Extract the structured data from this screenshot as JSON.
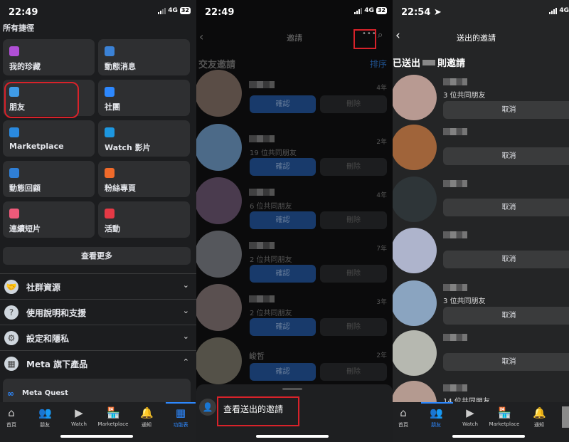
{
  "status_left": {
    "time": "22:49",
    "network": "4G",
    "battery": "32"
  },
  "status_mid": {
    "time": "22:49",
    "network": "4G",
    "battery": "32"
  },
  "status_right": {
    "time": "22:54",
    "network": "4G"
  },
  "menu": {
    "title": "所有捷徑",
    "shortcuts": [
      {
        "label": "我的珍藏",
        "icon": "bookmark-icon",
        "color": "#b04fd6"
      },
      {
        "label": "動態消息",
        "icon": "feed-icon",
        "color": "#3b82d6"
      },
      {
        "label": "朋友",
        "icon": "friends-icon",
        "color": "#3f9be6"
      },
      {
        "label": "社團",
        "icon": "groups-icon",
        "color": "#2d88ff"
      },
      {
        "label": "Marketplace",
        "icon": "marketplace-icon",
        "color": "#2a8ae0"
      },
      {
        "label": "Watch 影片",
        "icon": "watch-icon",
        "color": "#1d97e0"
      },
      {
        "label": "動態回顧",
        "icon": "memories-icon",
        "color": "#2f7fd6"
      },
      {
        "label": "粉絲專頁",
        "icon": "flag-icon",
        "color": "#f06a2a"
      },
      {
        "label": "連續短片",
        "icon": "reels-icon",
        "color": "#ef5a7a"
      },
      {
        "label": "活動",
        "icon": "calendar-icon",
        "color": "#e53945"
      }
    ],
    "see_more": "查看更多",
    "sections": [
      {
        "label": "社群資源",
        "icon": "handshake-icon",
        "chevron": "⌄"
      },
      {
        "label": "使用說明和支援",
        "icon": "help-icon",
        "chevron": "⌄"
      },
      {
        "label": "設定和隱私",
        "icon": "gear-icon",
        "chevron": "⌄"
      },
      {
        "label": "Meta 旗下產品",
        "icon": "grid-icon",
        "chevron": "⌃"
      }
    ],
    "meta_quest": "Meta Quest"
  },
  "tabs_left": [
    {
      "label": "首頁",
      "icon": "home-icon"
    },
    {
      "label": "朋友",
      "icon": "friends-icon"
    },
    {
      "label": "Watch",
      "icon": "watch-icon"
    },
    {
      "label": "Marketplace",
      "icon": "marketplace-icon"
    },
    {
      "label": "通知",
      "icon": "bell-icon"
    },
    {
      "label": "功能表",
      "icon": "profile-avatar-icon",
      "active": true
    }
  ],
  "requests": {
    "title": "邀請",
    "section": "交友邀請",
    "sort": "排序",
    "confirm": "確認",
    "delete": "刪除",
    "items": [
      {
        "name": "",
        "mutual": "",
        "age": "4年",
        "color": "#5a4d46"
      },
      {
        "name": "",
        "mutual": "19 位共同朋友",
        "age": "2年",
        "color": "#4c6a88"
      },
      {
        "name": "",
        "mutual": "6 位共同朋友",
        "age": "4年",
        "color": "#4a3b4e"
      },
      {
        "name": "",
        "mutual": "2 位共同朋友",
        "age": "7年",
        "color": "#55575c"
      },
      {
        "name": "",
        "mutual": "2 位共同朋友",
        "age": "3年",
        "color": "#5a5050"
      },
      {
        "name": "峻哲",
        "mutual": "",
        "age": "2年",
        "color": "#545148"
      }
    ],
    "sheet_action": "查看送出的邀請"
  },
  "sent": {
    "title": "送出的邀請",
    "count_prefix": "已送出",
    "count_suffix": "則邀請",
    "cancel": "取消",
    "items": [
      {
        "mutual": "3 位共同朋友",
        "color": "#b89a92"
      },
      {
        "mutual": "",
        "color": "#a0643a"
      },
      {
        "mutual": "",
        "color": "#2e3538"
      },
      {
        "mutual": "",
        "color": "#aeb4cc"
      },
      {
        "mutual": "3 位共同朋友",
        "color": "#8aa4c0"
      },
      {
        "mutual": "",
        "color": "#b6b8b0"
      },
      {
        "mutual": "14 位共同朋友",
        "color": "#b49a90"
      }
    ]
  },
  "tabs_right": [
    {
      "label": "首頁",
      "icon": "home-icon"
    },
    {
      "label": "朋友",
      "icon": "friends-icon",
      "active": true
    },
    {
      "label": "Watch",
      "icon": "watch-icon"
    },
    {
      "label": "Marketplace",
      "icon": "marketplace-icon"
    },
    {
      "label": "通知",
      "icon": "bell-icon"
    }
  ],
  "colors": {
    "accent": "#2d88ff",
    "highlight": "#d8222a"
  }
}
